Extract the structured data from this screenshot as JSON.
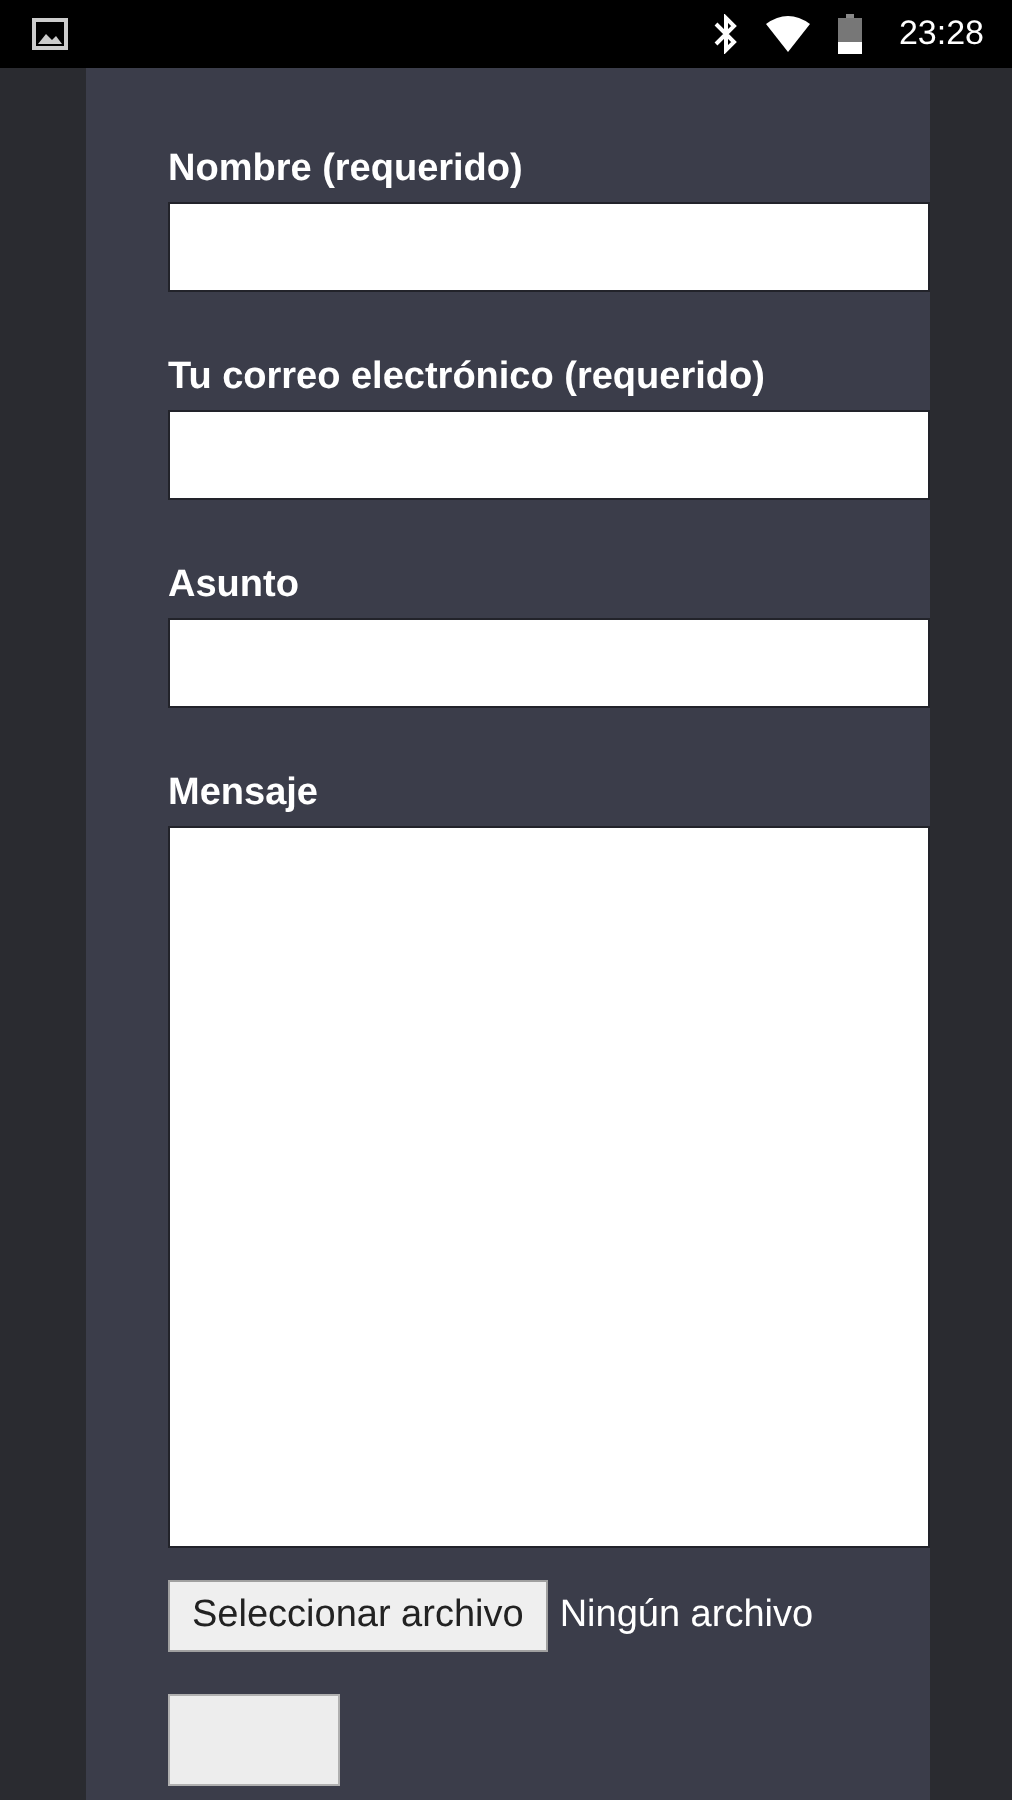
{
  "status_bar": {
    "time": "23:28"
  },
  "form": {
    "fields": [
      {
        "label": "Nombre (requerido)",
        "kind": "input"
      },
      {
        "label": "Tu correo electrónico (requerido)",
        "kind": "input"
      },
      {
        "label": "Asunto",
        "kind": "input"
      },
      {
        "label": "Mensaje",
        "kind": "textarea"
      }
    ],
    "file_button": "Seleccionar archivo",
    "file_status": "Ningún archivo"
  }
}
